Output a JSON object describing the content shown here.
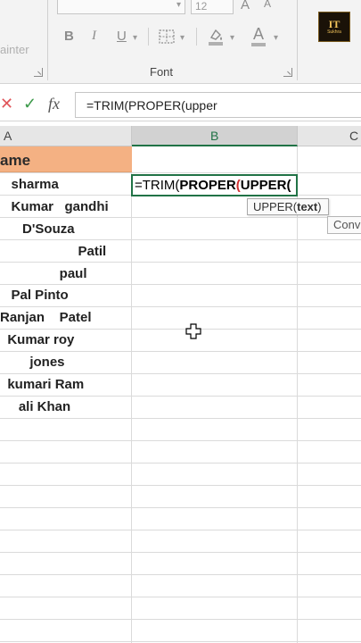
{
  "ribbon": {
    "painter_label": "ainter",
    "font_size_value": "12",
    "font_group_label": "Font",
    "controls": {
      "bold": "B",
      "italic": "I",
      "underline": "U",
      "font_color": "A",
      "grow": "A",
      "shrink": "A"
    }
  },
  "logo": {
    "title": "IT",
    "subtitle": "Sukhra"
  },
  "formula_bar": {
    "text": "=TRIM(PROPER(upper"
  },
  "columns": [
    {
      "label": "A"
    },
    {
      "label": "B"
    },
    {
      "label": "C"
    }
  ],
  "header_cell": "ame",
  "names": [
    "   sharma",
    "   Kumar   gandhi",
    "      D'Souza",
    "                     Patil",
    "                paul",
    "   Pal Pinto",
    "Ranjan    Patel",
    "  Kumar roy",
    "        jones",
    "  kumari Ram",
    "     ali Khan"
  ],
  "active_cell": {
    "prefix": "=TRIM(",
    "proper": "PROPER",
    "paren1": "(",
    "upper": "UPPER",
    "paren2": "("
  },
  "tooltip": {
    "func": "UPPER(",
    "arg": "text",
    "close": ")"
  },
  "suggestion": "Conv"
}
